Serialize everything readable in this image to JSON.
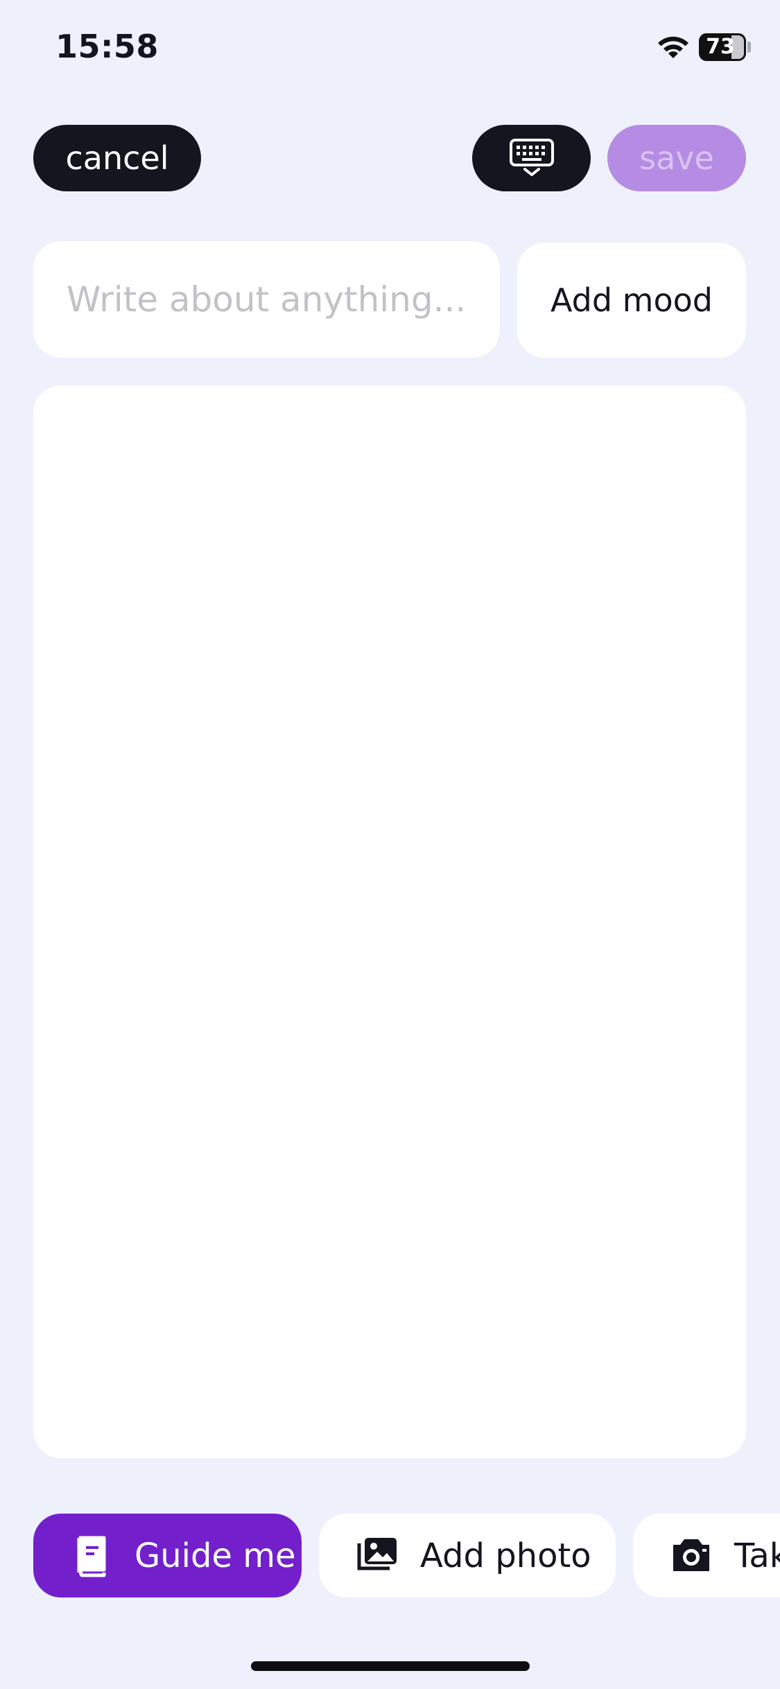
{
  "status_bar": {
    "time": "15:58",
    "battery": "73",
    "wifi_icon": "wifi-icon"
  },
  "header": {
    "cancel_label": "cancel",
    "keyboard_icon": "keyboard-dismiss-icon",
    "save_label": "save"
  },
  "entry": {
    "title_placeholder": "Write about anything...",
    "mood_label": "Add mood",
    "body_value": ""
  },
  "actions": [
    {
      "label": "Guide me",
      "icon": "book-icon"
    },
    {
      "label": "Add photo",
      "icon": "photo-gallery-icon"
    },
    {
      "label": "Take photo",
      "icon": "camera-icon"
    }
  ],
  "colors": {
    "background": "#eef1fc",
    "dark_button": "#15151f",
    "save_disabled": "#b58be3",
    "accent_purple": "#7320cc",
    "card": "#ffffff"
  }
}
